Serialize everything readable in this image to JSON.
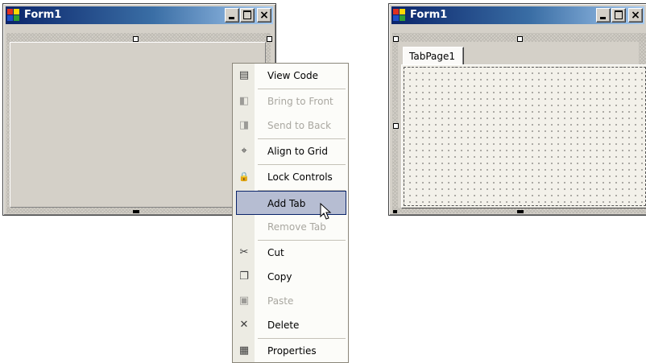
{
  "left_window": {
    "title": "Form1",
    "buttons": {
      "minimize": "minimize",
      "maximize": "maximize",
      "close": "×"
    }
  },
  "right_window": {
    "title": "Form1",
    "buttons": {
      "minimize": "minimize",
      "maximize": "maximize",
      "close": "×"
    },
    "tab_control": {
      "tabs": [
        {
          "label": "TabPage1",
          "selected": true
        }
      ]
    }
  },
  "context_menu": {
    "items": [
      {
        "label": "View Code",
        "icon": "view-code-icon",
        "glyph": "▤",
        "enabled": true
      },
      {
        "label": "Bring to Front",
        "icon": "bring-to-front-icon",
        "glyph": "◧",
        "enabled": false
      },
      {
        "label": "Send to Back",
        "icon": "send-to-back-icon",
        "glyph": "◨",
        "enabled": false
      },
      {
        "label": "Align to Grid",
        "icon": "align-to-grid-icon",
        "glyph": "⌖",
        "enabled": true
      },
      {
        "label": "Lock Controls",
        "icon": "lock-icon",
        "glyph": "🔒",
        "enabled": true
      },
      {
        "label": "Add Tab",
        "icon": "",
        "glyph": "",
        "enabled": true,
        "active": true
      },
      {
        "label": "Remove Tab",
        "icon": "",
        "glyph": "",
        "enabled": false
      },
      {
        "label": "Cut",
        "icon": "cut-icon",
        "glyph": "✂",
        "enabled": true
      },
      {
        "label": "Copy",
        "icon": "copy-icon",
        "glyph": "❐",
        "enabled": true
      },
      {
        "label": "Paste",
        "icon": "paste-icon",
        "glyph": "▣",
        "enabled": false
      },
      {
        "label": "Delete",
        "icon": "delete-icon",
        "glyph": "✕",
        "enabled": true
      },
      {
        "label": "Properties",
        "icon": "properties-icon",
        "glyph": "▦",
        "enabled": true
      }
    ]
  },
  "colors": {
    "title_gradient_start": "#0a246a",
    "title_gradient_end": "#a6caf0",
    "face": "#d4d0c8",
    "menu_highlight": "#b6bdd2"
  }
}
